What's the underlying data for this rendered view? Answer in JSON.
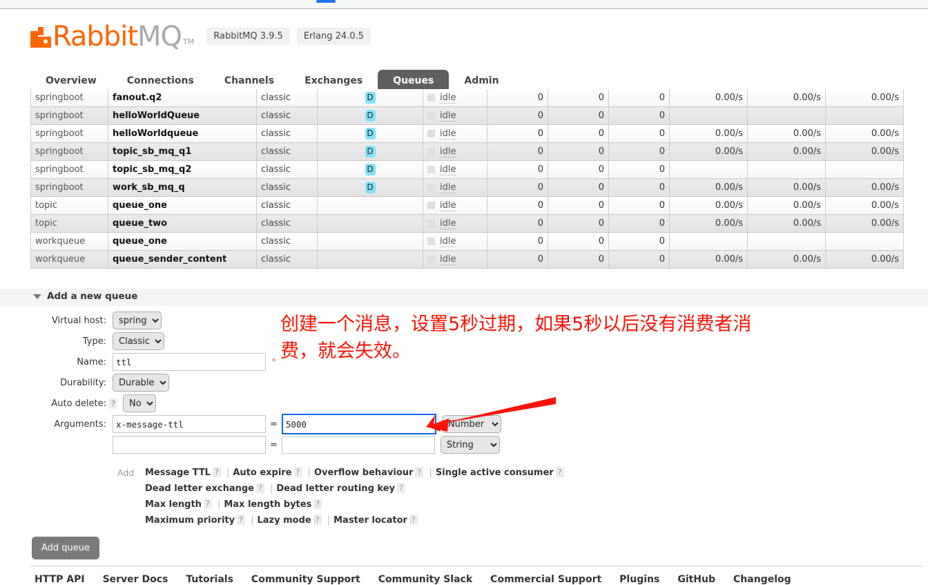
{
  "browser": {
    "tab_indicator": "active-tab"
  },
  "header": {
    "logo_rabbit": "Rabbit",
    "logo_mq": "MQ",
    "logo_tm": "TM",
    "version_badges": [
      "RabbitMQ 3.9.5",
      "Erlang 24.0.5"
    ]
  },
  "tabs": [
    {
      "label": "Overview",
      "active": false
    },
    {
      "label": "Connections",
      "active": false
    },
    {
      "label": "Channels",
      "active": false
    },
    {
      "label": "Exchanges",
      "active": false
    },
    {
      "label": "Queues",
      "active": true
    },
    {
      "label": "Admin",
      "active": false
    }
  ],
  "queues_table": {
    "feature_badge": "D",
    "state_label": "idle",
    "rows": [
      {
        "vhost": "springboot",
        "name": "fanout.q2",
        "type": "classic",
        "features": "D",
        "state": "idle",
        "ready": "0",
        "unacked": "0",
        "total": "0",
        "incoming": "0.00/s",
        "deliver_get": "0.00/s",
        "ack": "0.00/s"
      },
      {
        "vhost": "springboot",
        "name": "helloWorldQueue",
        "type": "classic",
        "features": "D",
        "state": "idle",
        "ready": "0",
        "unacked": "0",
        "total": "0",
        "incoming": "",
        "deliver_get": "",
        "ack": ""
      },
      {
        "vhost": "springboot",
        "name": "helloWorldqueue",
        "type": "classic",
        "features": "D",
        "state": "idle",
        "ready": "0",
        "unacked": "0",
        "total": "0",
        "incoming": "0.00/s",
        "deliver_get": "0.00/s",
        "ack": "0.00/s"
      },
      {
        "vhost": "springboot",
        "name": "topic_sb_mq_q1",
        "type": "classic",
        "features": "D",
        "state": "idle",
        "ready": "0",
        "unacked": "0",
        "total": "0",
        "incoming": "0.00/s",
        "deliver_get": "0.00/s",
        "ack": "0.00/s"
      },
      {
        "vhost": "springboot",
        "name": "topic_sb_mq_q2",
        "type": "classic",
        "features": "D",
        "state": "idle",
        "ready": "0",
        "unacked": "0",
        "total": "0",
        "incoming": "",
        "deliver_get": "",
        "ack": ""
      },
      {
        "vhost": "springboot",
        "name": "work_sb_mq_q",
        "type": "classic",
        "features": "D",
        "state": "idle",
        "ready": "0",
        "unacked": "0",
        "total": "0",
        "incoming": "0.00/s",
        "deliver_get": "0.00/s",
        "ack": "0.00/s"
      },
      {
        "vhost": "topic",
        "name": "queue_one",
        "type": "classic",
        "features": "",
        "state": "idle",
        "ready": "0",
        "unacked": "0",
        "total": "0",
        "incoming": "0.00/s",
        "deliver_get": "0.00/s",
        "ack": "0.00/s"
      },
      {
        "vhost": "topic",
        "name": "queue_two",
        "type": "classic",
        "features": "",
        "state": "idle",
        "ready": "0",
        "unacked": "0",
        "total": "0",
        "incoming": "0.00/s",
        "deliver_get": "0.00/s",
        "ack": "0.00/s"
      },
      {
        "vhost": "workqueue",
        "name": "queue_one",
        "type": "classic",
        "features": "",
        "state": "idle",
        "ready": "0",
        "unacked": "0",
        "total": "0",
        "incoming": "",
        "deliver_get": "",
        "ack": ""
      },
      {
        "vhost": "workqueue",
        "name": "queue_sender_content",
        "type": "classic",
        "features": "",
        "state": "idle",
        "ready": "0",
        "unacked": "0",
        "total": "0",
        "incoming": "0.00/s",
        "deliver_get": "0.00/s",
        "ack": "0.00/s"
      }
    ]
  },
  "add_queue": {
    "section_title": "Add a new queue",
    "labels": {
      "virtual_host": "Virtual host:",
      "type": "Type:",
      "name": "Name:",
      "durability": "Durability:",
      "auto_delete": "Auto delete:",
      "arguments": "Arguments:"
    },
    "values": {
      "virtual_host": "spring",
      "type": "Classic",
      "name": "ttl",
      "durability": "Durable",
      "auto_delete": "No",
      "arg_key_1": "x-message-ttl",
      "arg_val_1": "5000",
      "arg_type_1": "Number",
      "arg_key_2": "",
      "arg_val_2": "",
      "arg_type_2": "String"
    },
    "name_required_mark": "*",
    "help_mark": "?",
    "equals": "=",
    "add_word": "Add",
    "presets": [
      [
        "Message TTL",
        "Auto expire",
        "Overflow behaviour",
        "Single active consumer"
      ],
      [
        "Dead letter exchange",
        "Dead letter routing key"
      ],
      [
        "Max length",
        "Max length bytes"
      ],
      [
        "Maximum priority",
        "Lazy mode",
        "Master locator"
      ]
    ],
    "submit_label": "Add queue"
  },
  "annotation": {
    "text": "创建一个消息，设置5秒过期，如果5秒以后没有消费者消费，就会失效。",
    "color": "#fe1205"
  },
  "footer": {
    "links": [
      "HTTP API",
      "Server Docs",
      "Tutorials",
      "Community Support",
      "Community Slack",
      "Commercial Support",
      "Plugins",
      "GitHub",
      "Changelog"
    ]
  },
  "colors": {
    "brand_orange": "#ff6600",
    "active_tab_bg": "#5f5f5f",
    "durable_badge": "#7fe3fb",
    "focus_border": "#1266dd",
    "annotation_red": "#fe1205"
  }
}
